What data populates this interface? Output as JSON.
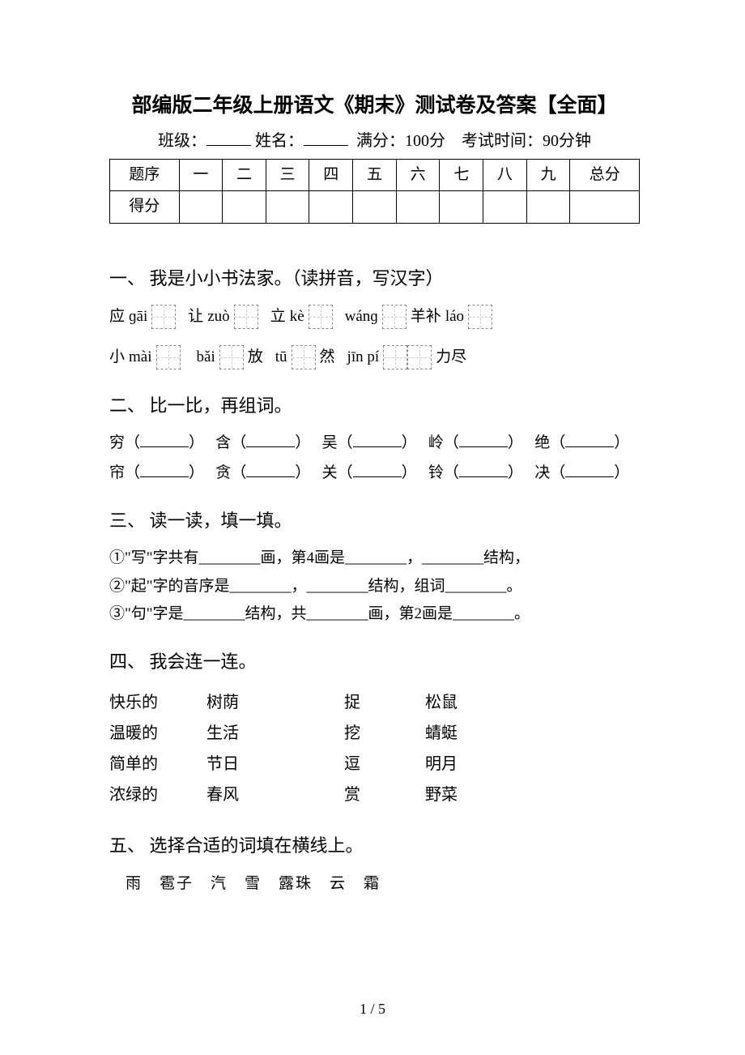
{
  "title": "部编版二年级上册语文《期末》测试卷及答案【全面】",
  "meta": {
    "class_label": "班级：",
    "name_label": "姓名：",
    "score_label": "满分：100分",
    "time_label": "考试时间：90分钟"
  },
  "score_table": {
    "row1_label": "题序",
    "cols": [
      "一",
      "二",
      "三",
      "四",
      "五",
      "六",
      "七",
      "八",
      "九",
      "总分"
    ],
    "row2_label": "得分"
  },
  "sections": {
    "s1": {
      "title": "一、 我是小小书法家。（读拼音，写汉字）",
      "row1": [
        {
          "pre": "应",
          "pinyin": "ɡāi",
          "boxes": 1
        },
        {
          "pre": "让",
          "pinyin": "zuò",
          "boxes": 1
        },
        {
          "pre": "立",
          "pinyin": "kè",
          "boxes": 1
        },
        {
          "pre": "",
          "pinyin": "wánɡ",
          "boxes": 1,
          "post": "羊补"
        },
        {
          "pre": "",
          "pinyin": "láo",
          "boxes": 1
        }
      ],
      "row2": [
        {
          "pre": "小",
          "pinyin": "mài",
          "boxes": 1
        },
        {
          "pre": "",
          "pinyin": "bǎi",
          "boxes": 1,
          "post": "放"
        },
        {
          "pre": "",
          "pinyin": "tū",
          "boxes": 1,
          "post": "然"
        },
        {
          "pre": "",
          "pinyin": "jīn pí",
          "boxes": 2,
          "post": "力尽"
        }
      ]
    },
    "s2": {
      "title": "二、 比一比，再组词。",
      "row1": [
        "穷",
        "含",
        "吴",
        "岭",
        "绝"
      ],
      "row2": [
        "帘",
        "贪",
        "关",
        "铃",
        "决"
      ]
    },
    "s3": {
      "title": "三、 读一读，填一填。",
      "lines": [
        "①\"写\"字共有________画，第4画是________，________结构，",
        "②\"起\"字的音序是________，________结构，组词________。",
        "③\"句\"字是________结构，共________画，第2画是________。"
      ]
    },
    "s4": {
      "title": "四、 我会连一连。",
      "col1": [
        "快乐的",
        "温暖的",
        "简单的",
        "浓绿的"
      ],
      "col2": [
        "树荫",
        "生活",
        "节日",
        "春风"
      ],
      "col3": [
        "捉",
        "挖",
        "逗",
        "赏"
      ],
      "col4": [
        "松鼠",
        "蜻蜓",
        "明月",
        "野菜"
      ]
    },
    "s5": {
      "title": "五、 选择合适的词填在横线上。",
      "words": "雨　雹子　汽　雪　露珠　云　霜"
    }
  },
  "page_num": "1 / 5"
}
